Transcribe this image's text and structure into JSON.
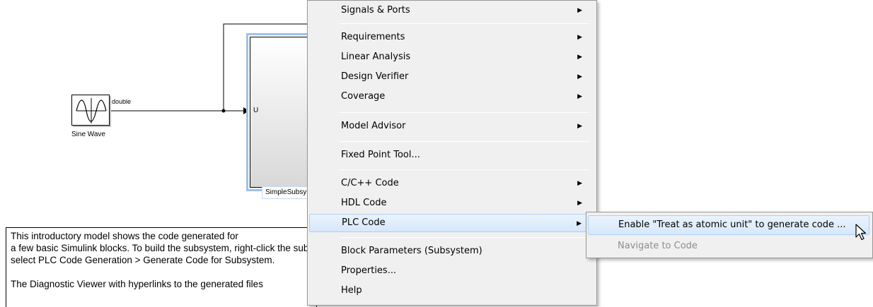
{
  "diagram": {
    "sine_block_label": "Sine Wave",
    "signal_type": "double",
    "inport_label": "U",
    "subsystem_name": "SimpleSubsystem"
  },
  "annotation": {
    "lines": [
      "This introductory model shows the code generated for",
      "a few basic Simulink blocks.  To build the subsystem, right-click the subsystem and",
      "select PLC Code Generation > Generate Code for Subsystem.",
      "",
      "The Diagnostic Viewer with hyperlinks to the generated files"
    ]
  },
  "context_menu": {
    "items": [
      {
        "label": "Signals & Ports",
        "submenu": true
      },
      {
        "label": "Requirements",
        "submenu": true
      },
      {
        "label": "Linear Analysis",
        "submenu": true
      },
      {
        "label": "Design Verifier",
        "submenu": true
      },
      {
        "label": "Coverage",
        "submenu": true
      },
      {
        "label": "Model Advisor",
        "submenu": true
      },
      {
        "label": "Fixed Point Tool...",
        "submenu": false
      },
      {
        "label": "C/C++ Code",
        "submenu": true
      },
      {
        "label": "HDL Code",
        "submenu": true
      },
      {
        "label": "PLC Code",
        "submenu": true,
        "highlighted": true
      },
      {
        "label": "Block Parameters (Subsystem)",
        "submenu": false
      },
      {
        "label": "Properties...",
        "submenu": false
      },
      {
        "label": "Help",
        "submenu": false
      }
    ],
    "arrow_glyph": "▶"
  },
  "plc_submenu": {
    "items": [
      {
        "label": "Enable \"Treat as atomic unit\" to generate code ...",
        "enabled": true,
        "highlighted": true
      },
      {
        "label": "Navigate to Code",
        "enabled": false
      }
    ]
  },
  "colors": {
    "menu_bg": "#f0f0f0",
    "highlight_border": "#aecff7",
    "selection_outline": "#9fc2ea",
    "disabled_text": "#8d8d8d"
  }
}
